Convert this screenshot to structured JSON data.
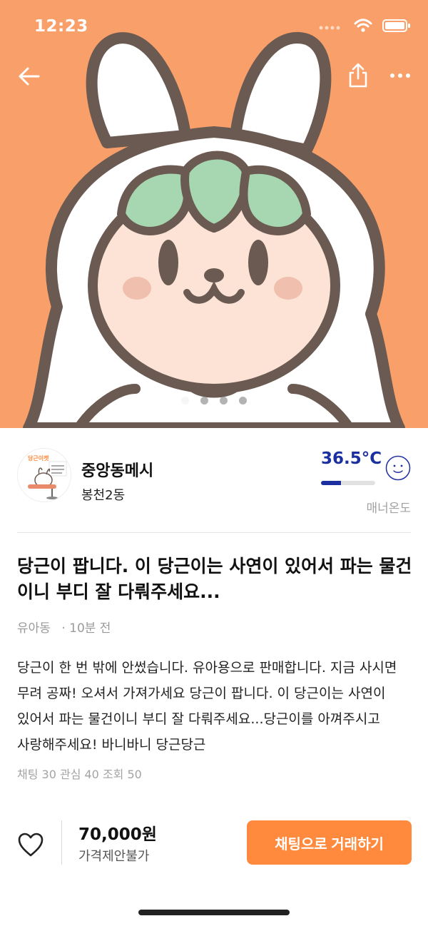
{
  "status_bar": {
    "time": "12:23"
  },
  "hero": {
    "image_alt": "bunny-hood carrot character illustration",
    "page_dots": 4,
    "active_dot": 0,
    "background_color": "#F9A06A"
  },
  "seller": {
    "name": "중앙동메시",
    "location": "봉천2동",
    "manner_temp": "36.5°C",
    "manner_temp_value": 36.5,
    "manner_label": "매너온도",
    "avatar_text": "당근이켓",
    "temp_color": "#1c2f9e"
  },
  "post": {
    "title": "당근이 팝니다. 이 당근이는 사연이 있어서 파는 물건이니 부디 잘 다뤄주세요...",
    "category": "유아동",
    "time_ago": "· 10분 전",
    "body": "당근이 한 번 밖에 안썼습니다. 유아용으로 판매합니다. 지금 사시면 무려 공짜! 오셔서 가져가세요 당근이 팝니다. 이 당근이는 사연이 있어서 파는 물건이니 부디 잘 다뤄주세요...당근이를 아껴주시고 사랑해주세요! 바니바니 당근당근",
    "stats": "채팅 30 관심 40 조회 50"
  },
  "bottom_bar": {
    "price": "70,000원",
    "price_note": "가격제안불가",
    "chat_button": "채팅으로 거래하기",
    "button_color": "#FF8A3D"
  }
}
